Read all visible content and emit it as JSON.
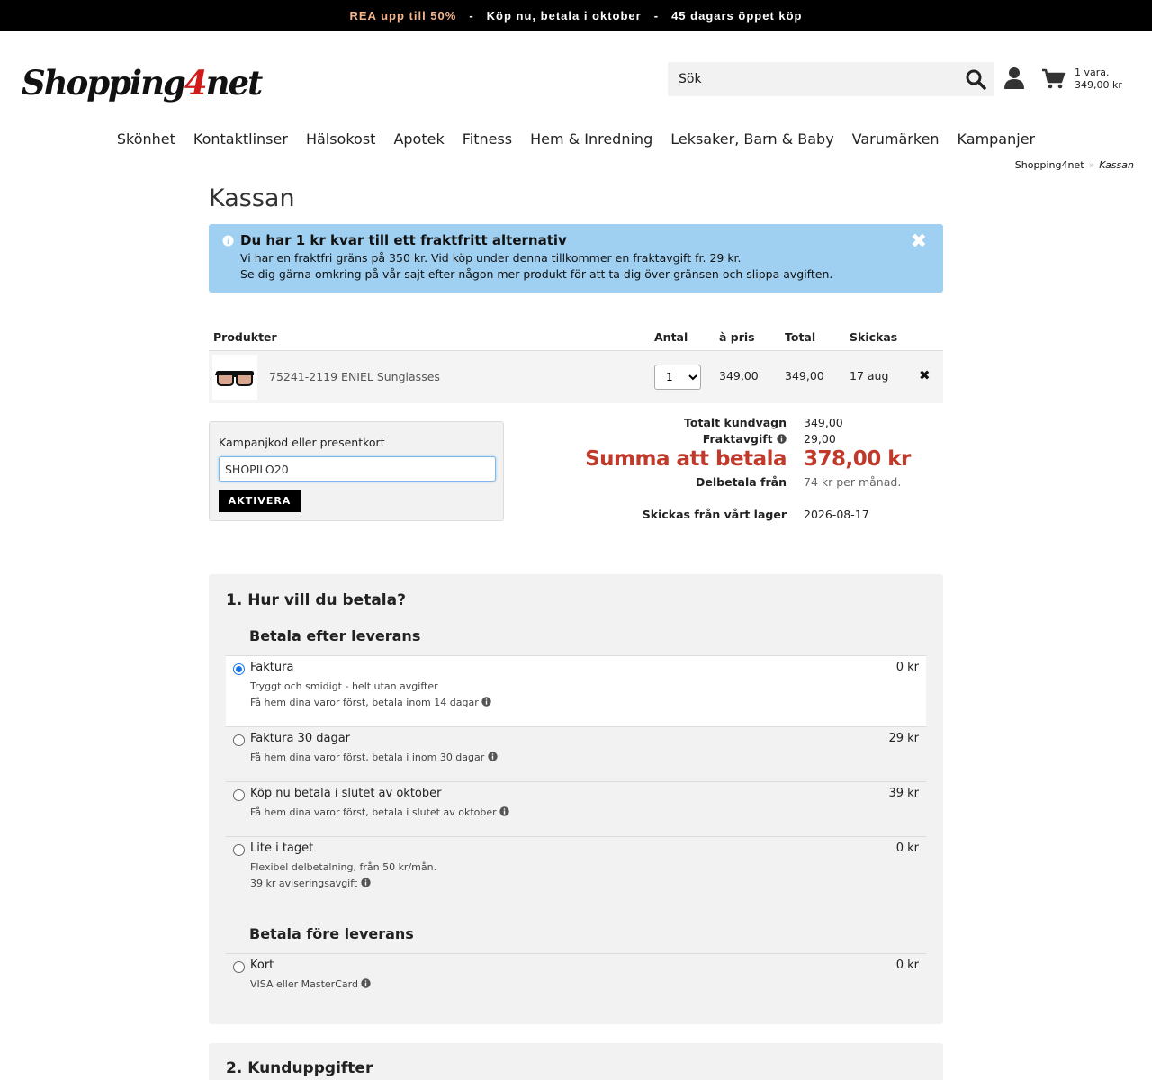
{
  "topbar": {
    "promo": "REA upp till 50%",
    "sep1": "-",
    "msg1": "Köp nu, betala i oktober",
    "sep2": "-",
    "msg2": "45 dagars öppet köp"
  },
  "logo": {
    "part1": "Shopping",
    "part2": "4",
    "part3": "net"
  },
  "search": {
    "placeholder": "Sök"
  },
  "cart": {
    "count": "1 vara.",
    "amount": "349,00 kr"
  },
  "nav": [
    "Skönhet",
    "Kontaktlinser",
    "Hälsokost",
    "Apotek",
    "Fitness",
    "Hem & Inredning",
    "Leksaker, Barn & Baby",
    "Varumärken",
    "Kampanjer"
  ],
  "breadcrumb": {
    "home": "Shopping4net",
    "sep": "»",
    "current": "Kassan"
  },
  "page_title": "Kassan",
  "alert": {
    "title": "Du har 1 kr kvar till ett fraktfritt alternativ",
    "line1": "Vi har en fraktfri gräns på 350 kr. Vid köp under denna tillkommer en fraktavgift fr. 29 kr.",
    "line2": "Se dig gärna omkring på vår sajt efter någon mer produkt för att ta dig över gränsen och slippa avgiften.",
    "close": "✖"
  },
  "table": {
    "headers": {
      "product": "Produkter",
      "qty": "Antal",
      "price": "à pris",
      "total": "Total",
      "ships": "Skickas"
    },
    "row": {
      "name": "75241-2119 ENIEL Sunglasses",
      "qty": "1",
      "price": "349,00",
      "total": "349,00",
      "ships": "17 aug",
      "remove": "✖"
    }
  },
  "promo": {
    "label": "Kampanjkod eller presentkort",
    "value": "SHOPILO20",
    "button": "AKTIVERA"
  },
  "summary": {
    "cart_total_label": "Totalt kundvagn",
    "cart_total": "349,00",
    "shipping_label": "Fraktavgift",
    "shipping": "29,00",
    "pay_label": "Summa att betala",
    "pay": "378,00 kr",
    "installment_label": "Delbetala från",
    "installment": "74 kr per månad.",
    "ship_from_label": "Skickas från vårt lager",
    "ship_date": "2026-08-17"
  },
  "payment": {
    "title": "1. Hur vill du betala?",
    "after_title": "Betala efter leverans",
    "before_title": "Betala före leverans",
    "options": [
      {
        "name": "Faktura",
        "price": "0 kr",
        "d1": "Tryggt och smidigt - helt utan avgifter",
        "d2": "Få hem dina varor först, betala inom 14 dagar",
        "selected": true
      },
      {
        "name": "Faktura 30 dagar",
        "price": "29 kr",
        "d1": "Få hem dina varor först, betala i inom 30 dagar",
        "d2": "",
        "selected": false
      },
      {
        "name": "Köp nu betala i slutet av oktober",
        "price": "39 kr",
        "d1": "Få hem dina varor först, betala i slutet av oktober",
        "d2": "",
        "selected": false
      },
      {
        "name": "Lite i taget",
        "price": "0 kr",
        "d1": "Flexibel delbetalning, från 50 kr/mån.",
        "d2": "39 kr aviseringsavgift",
        "selected": false
      },
      {
        "name": "Kort",
        "price": "0 kr",
        "d1": "VISA eller MasterCard",
        "d2": "",
        "selected": false
      }
    ]
  },
  "customer": {
    "title": "2. Kunduppgifter"
  },
  "colors": {
    "accent_red": "#c0392b",
    "alert_bg": "#9fd0f1",
    "promo_orange": "#f5b58a"
  }
}
